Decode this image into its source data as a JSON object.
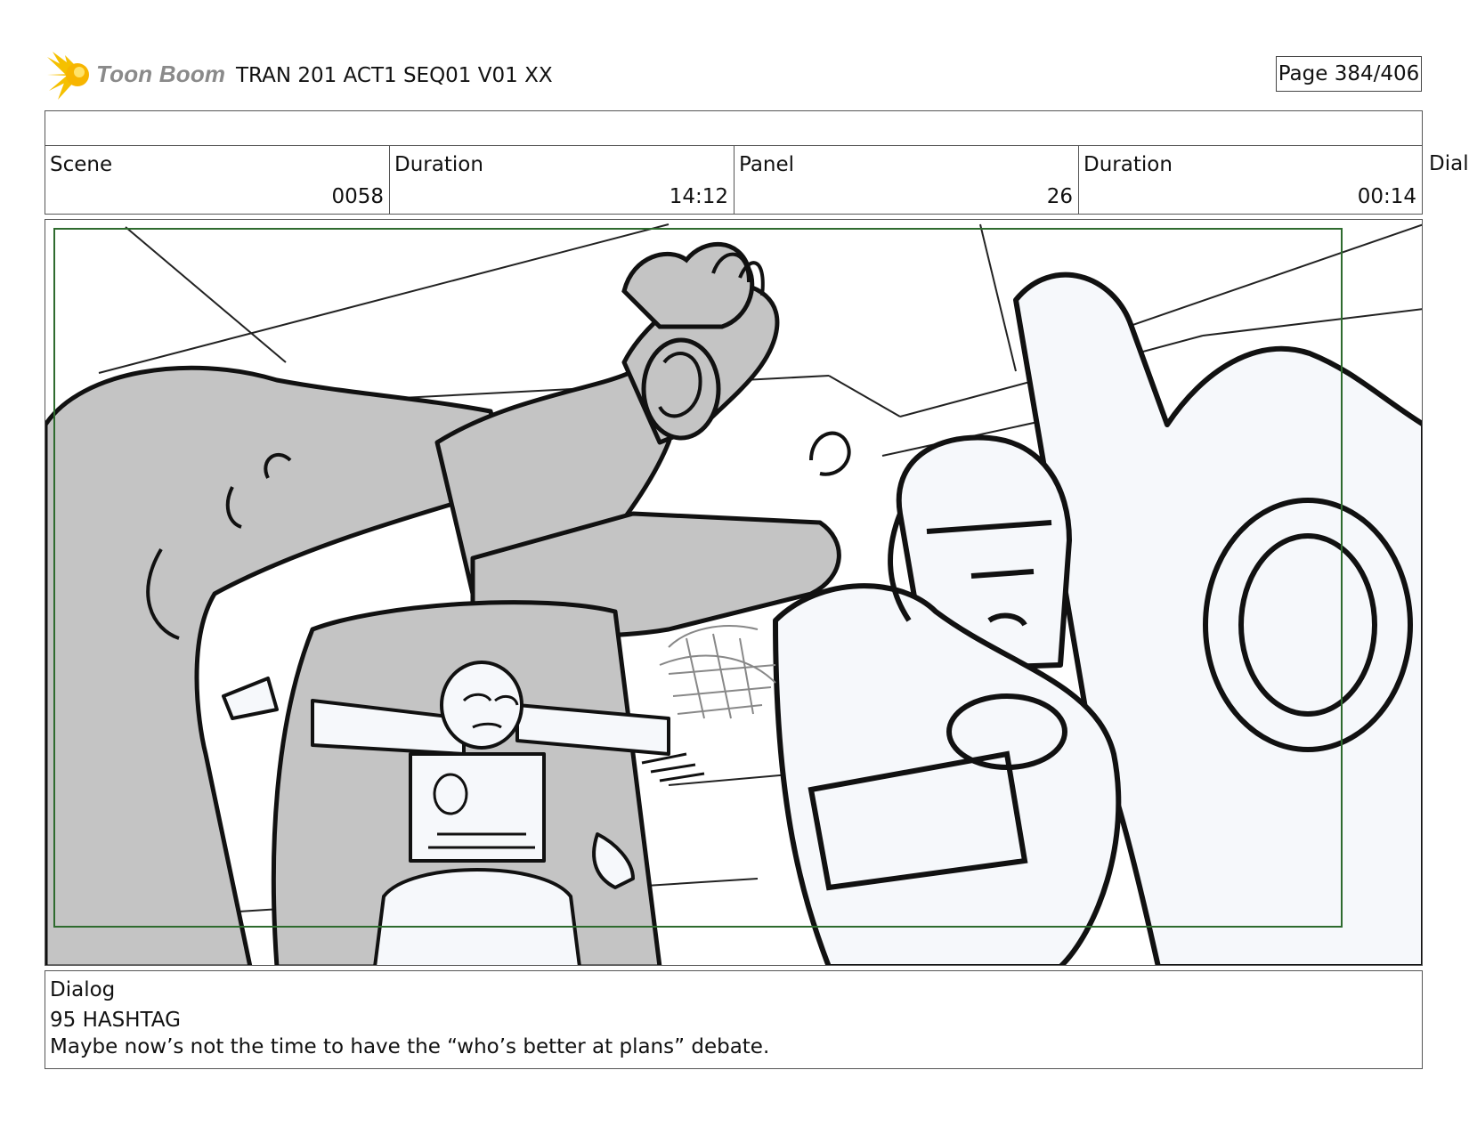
{
  "header": {
    "logo_text": "Toon Boom",
    "project_title": "TRAN 201 ACT1 SEQ01 V01 XX",
    "page_label": "Page 384/406"
  },
  "info": {
    "scene_label": "Scene",
    "scene_value": "0058",
    "scene_duration_label": "Duration",
    "scene_duration_value": "14:12",
    "panel_label": "Panel",
    "panel_value": "26",
    "panel_duration_label": "Duration",
    "panel_duration_value": "00:14",
    "overflow_label": "Dialo"
  },
  "panel_image": {
    "icon": "storyboard-sketch",
    "description_colors": {
      "safe_frame": "#2e6b2e",
      "shadow_fill": "#c4c4c4",
      "light_fill": "#f6f8fb",
      "ink": "#111111"
    }
  },
  "dialog": {
    "label": "Dialog",
    "speaker": "95 HASHTAG",
    "line": "Maybe now’s not the time to have the “who’s better at plans” debate."
  }
}
